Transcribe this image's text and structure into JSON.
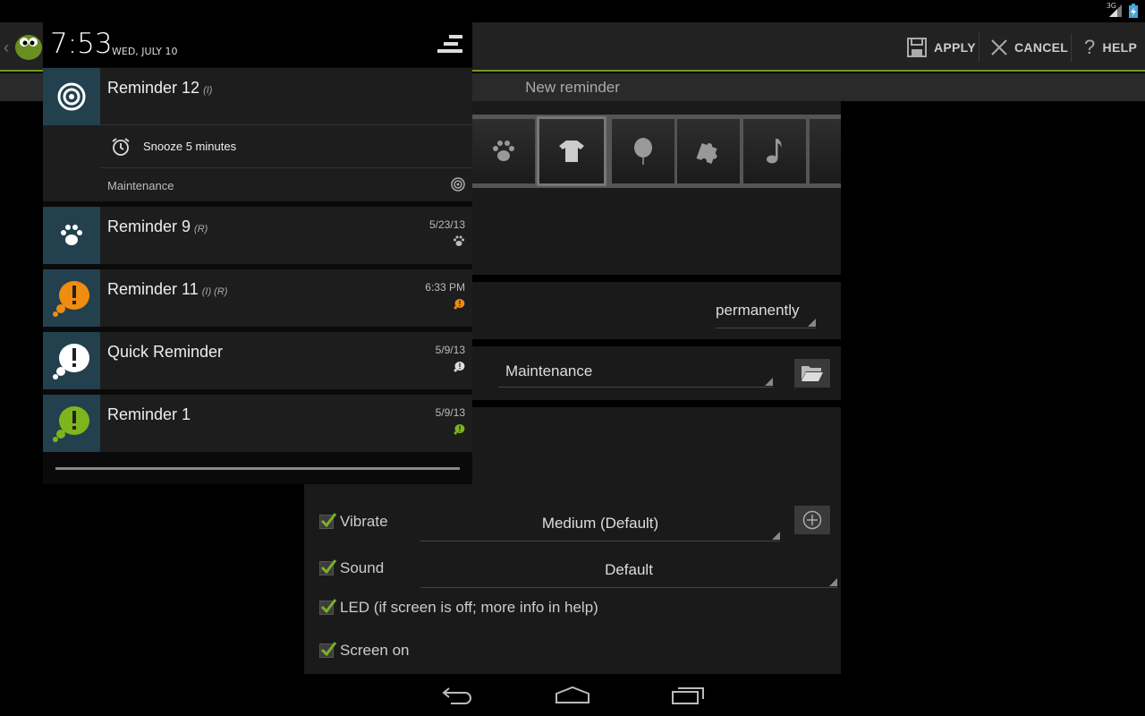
{
  "status_bar": {
    "network_label": "3G"
  },
  "action_bar": {
    "apply_label": "APPLY",
    "cancel_label": "CANCEL",
    "help_label": "HELP",
    "accent_color": "#6f9b22"
  },
  "subtitle": {
    "title": "New reminder"
  },
  "form": {
    "icon_strip": [
      "paw-icon",
      "tshirt-icon",
      "balloon-icon",
      "puzzle-icon",
      "music-note-icon",
      "more-icon"
    ],
    "selected_icon": "tshirt-icon",
    "duration_value": "permanently",
    "category_value": "Maintenance",
    "vibrate": {
      "label": "Vibrate",
      "checked": true,
      "value": "Medium (Default)"
    },
    "sound": {
      "label": "Sound",
      "checked": true,
      "value": "Default"
    },
    "led": {
      "label": "LED (if screen is off; more info in help)",
      "checked": true
    },
    "screen_on": {
      "label": "Screen on",
      "checked": true
    }
  },
  "shade": {
    "time": "7:53",
    "date": "WED, JULY 10",
    "expanded": {
      "title": "Reminder 12",
      "flags": "(I)",
      "action_label": "Snooze 5 minutes",
      "category": "Maintenance"
    },
    "notifications": [
      {
        "title": "Reminder 9",
        "flags": "(R)",
        "time": "5/23/13",
        "icon": "paw-icon"
      },
      {
        "title": "Reminder 11",
        "flags": "(I) (R)",
        "time": "6:33 PM",
        "icon": "orange-alert-bubble-icon"
      },
      {
        "title": "Quick Reminder",
        "flags": "",
        "time": "5/9/13",
        "icon": "white-alert-bubble-icon"
      },
      {
        "title": "Reminder 1",
        "flags": "",
        "time": "5/9/13",
        "icon": "green-alert-bubble-icon"
      }
    ]
  }
}
